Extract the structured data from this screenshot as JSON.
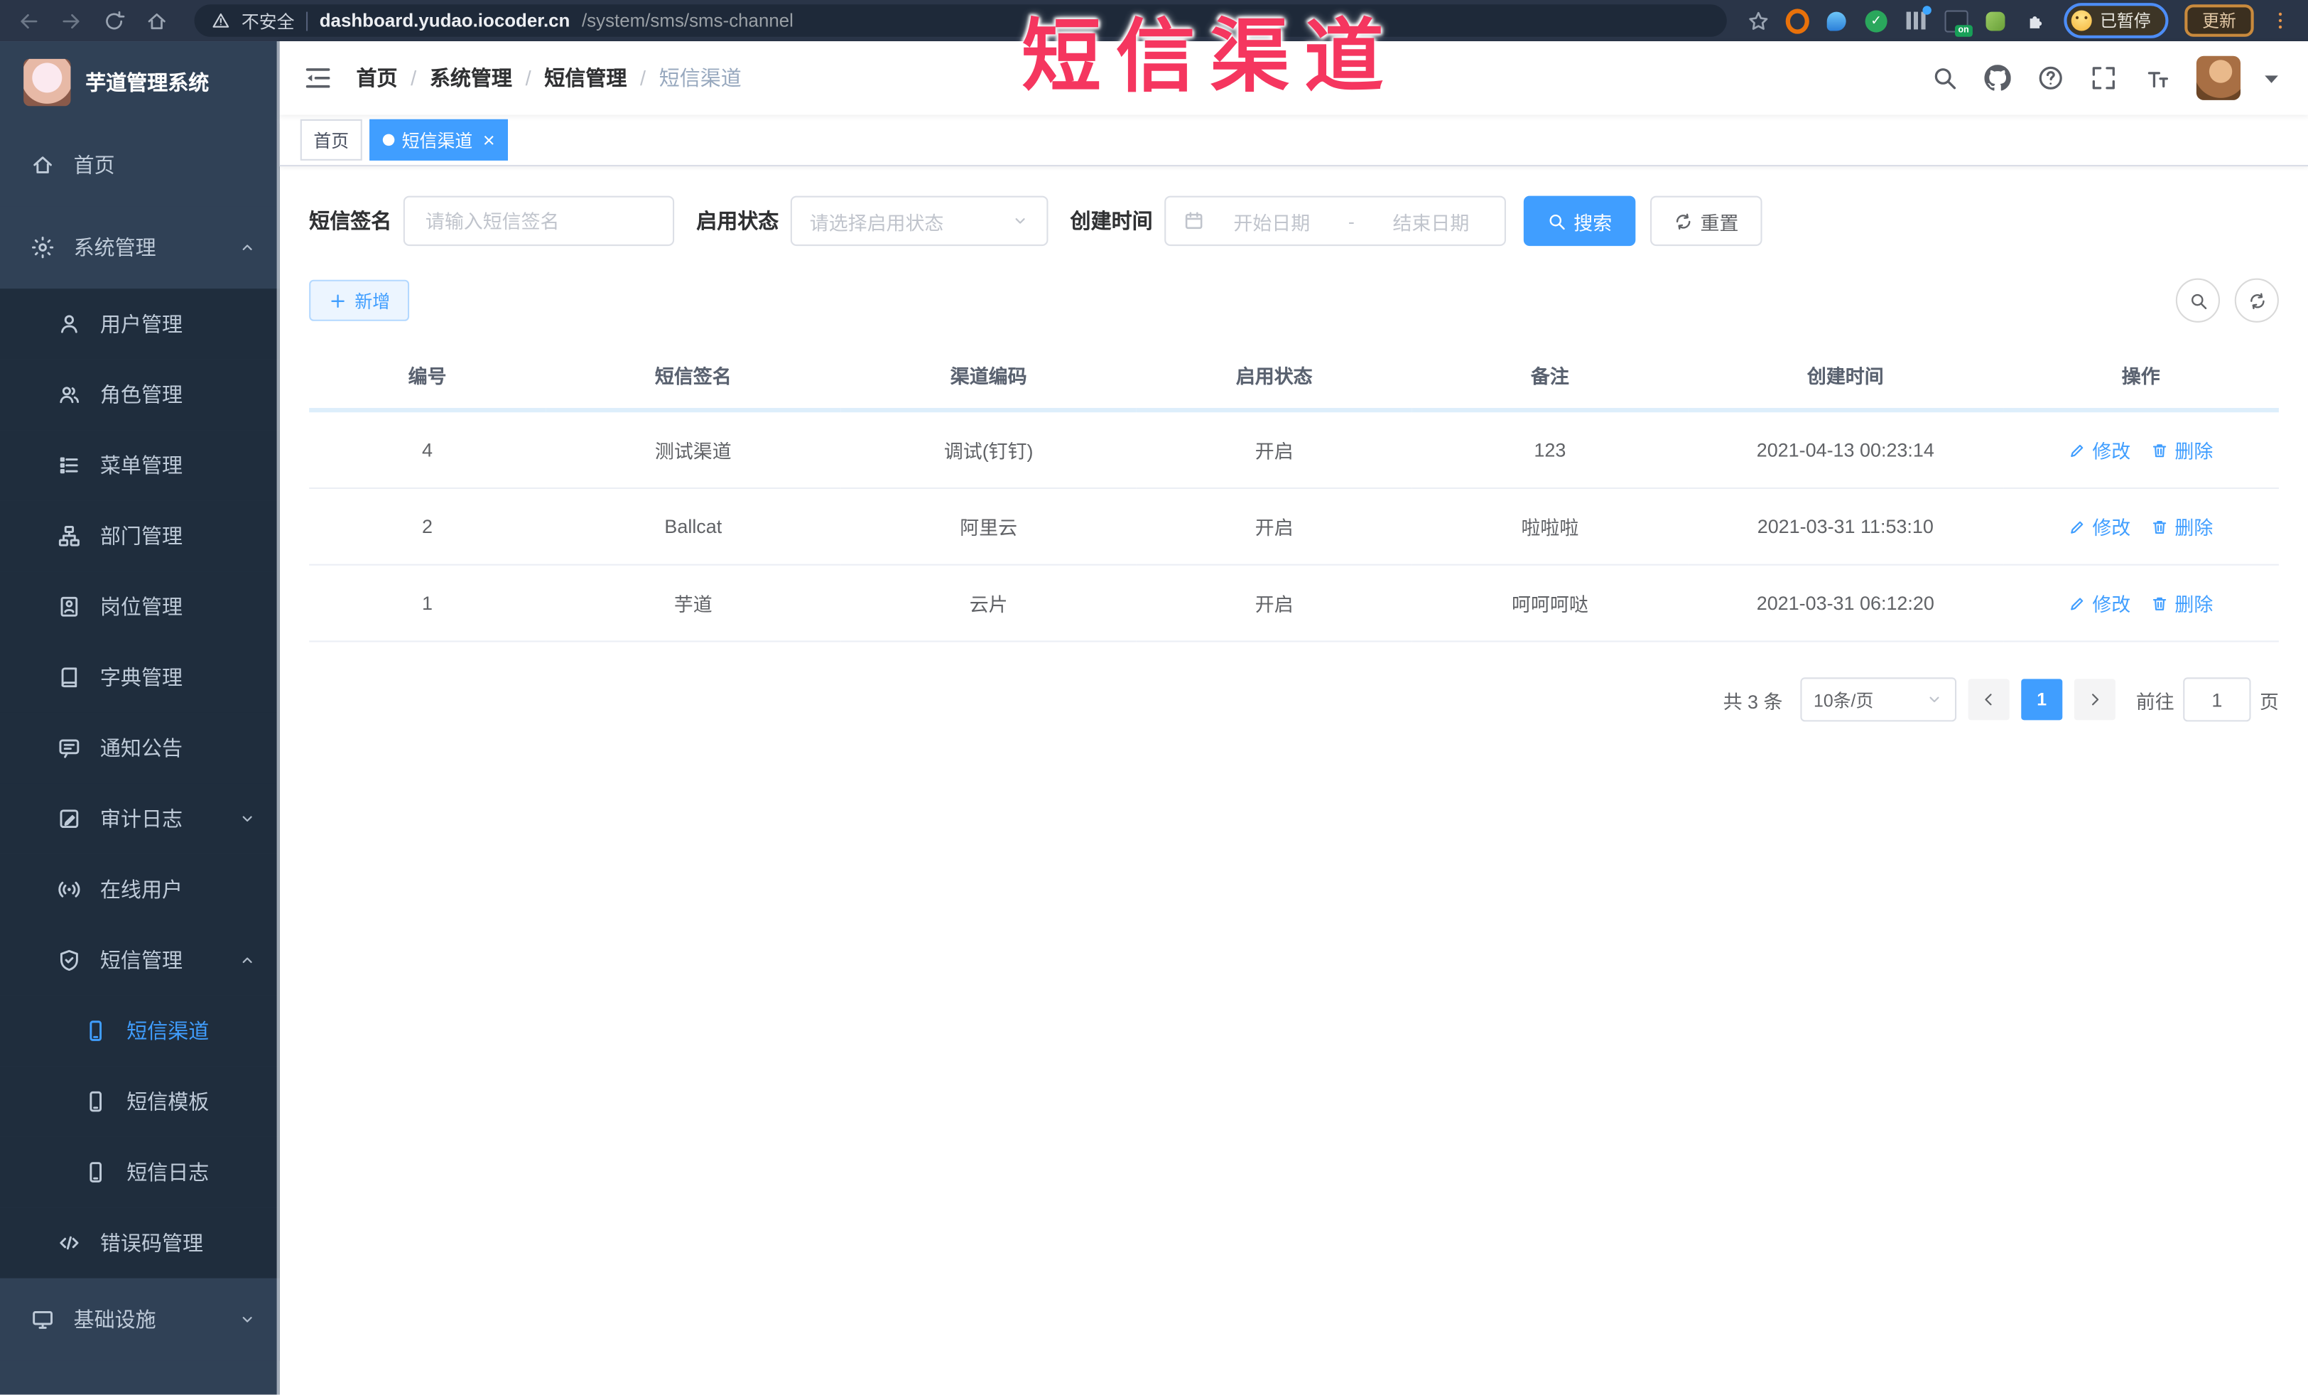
{
  "theme": {
    "accent": "#409eff",
    "sidebar_bg": "#304156",
    "submenu_bg": "#1f2d3d",
    "overlay_color": "#f5365f"
  },
  "browser": {
    "security_label": "不安全",
    "url_host": "dashboard.yudao.iocoder.cn",
    "url_path": "/system/sms/sms-channel",
    "extension_on_badge": "on",
    "paused_badge": "已暂停",
    "update_button": "更新"
  },
  "overlay": {
    "title": "短信渠道"
  },
  "sidebar": {
    "app_title": "芋道管理系统",
    "items": [
      {
        "id": "home",
        "label": "首页",
        "icon": "home",
        "depth": 0
      },
      {
        "id": "system",
        "label": "系统管理",
        "icon": "gear",
        "depth": 0,
        "arrow": "up"
      },
      {
        "id": "user-mgmt",
        "label": "用户管理",
        "icon": "user",
        "depth": 1
      },
      {
        "id": "role-mgmt",
        "label": "角色管理",
        "icon": "users",
        "depth": 1
      },
      {
        "id": "menu-mgmt",
        "label": "菜单管理",
        "icon": "menu-list",
        "depth": 1
      },
      {
        "id": "dept-mgmt",
        "label": "部门管理",
        "icon": "tree",
        "depth": 1
      },
      {
        "id": "post-mgmt",
        "label": "岗位管理",
        "icon": "badge",
        "depth": 1
      },
      {
        "id": "dict-mgmt",
        "label": "字典管理",
        "icon": "dictionary",
        "depth": 1
      },
      {
        "id": "notice",
        "label": "通知公告",
        "icon": "announcement",
        "depth": 1
      },
      {
        "id": "audit-log",
        "label": "审计日志",
        "icon": "log",
        "depth": 1,
        "arrow": "down"
      },
      {
        "id": "online-user",
        "label": "在线用户",
        "icon": "online",
        "depth": 1
      },
      {
        "id": "sms-mgmt",
        "label": "短信管理",
        "icon": "shield",
        "depth": 1,
        "arrow": "up"
      },
      {
        "id": "sms-channel",
        "label": "短信渠道",
        "icon": "phone",
        "depth": 2,
        "active": true
      },
      {
        "id": "sms-template",
        "label": "短信模板",
        "icon": "phone",
        "depth": 2
      },
      {
        "id": "sms-log",
        "label": "短信日志",
        "icon": "phone",
        "depth": 2
      },
      {
        "id": "error-code",
        "label": "错误码管理",
        "icon": "code",
        "depth": 1
      },
      {
        "id": "infra",
        "label": "基础设施",
        "icon": "monitor",
        "depth": 0,
        "arrow": "down"
      }
    ]
  },
  "breadcrumb": {
    "items": [
      "首页",
      "系统管理",
      "短信管理",
      "短信渠道"
    ]
  },
  "tabs": [
    {
      "id": "home",
      "label": "首页",
      "active": false,
      "closable": false
    },
    {
      "id": "sms-channel",
      "label": "短信渠道",
      "active": true,
      "closable": true
    }
  ],
  "search_form": {
    "sign_label": "短信签名",
    "sign_placeholder": "请输入短信签名",
    "status_label": "启用状态",
    "status_placeholder": "请选择启用状态",
    "time_label": "创建时间",
    "start_placeholder": "开始日期",
    "range_separator": "-",
    "end_placeholder": "结束日期",
    "search_button": "搜索",
    "reset_button": "重置"
  },
  "toolbar": {
    "add_button": "新增"
  },
  "table": {
    "headers": [
      "编号",
      "短信签名",
      "渠道编码",
      "启用状态",
      "备注",
      "创建时间",
      "操作"
    ],
    "rows": [
      {
        "id": "4",
        "sign": "测试渠道",
        "code": "调试(钉钉)",
        "status": "开启",
        "remark": "123",
        "created": "2021-04-13 00:23:14"
      },
      {
        "id": "2",
        "sign": "Ballcat",
        "code": "阿里云",
        "status": "开启",
        "remark": "啦啦啦",
        "created": "2021-03-31 11:53:10"
      },
      {
        "id": "1",
        "sign": "芋道",
        "code": "云片",
        "status": "开启",
        "remark": "呵呵呵哒",
        "created": "2021-03-31 06:12:20"
      }
    ],
    "edit_label": "修改",
    "delete_label": "删除"
  },
  "pagination": {
    "total_text": "共 3 条",
    "page_size": "10条/页",
    "current_page": "1",
    "goto_label": "前往",
    "goto_value": "1",
    "page_suffix": "页"
  }
}
